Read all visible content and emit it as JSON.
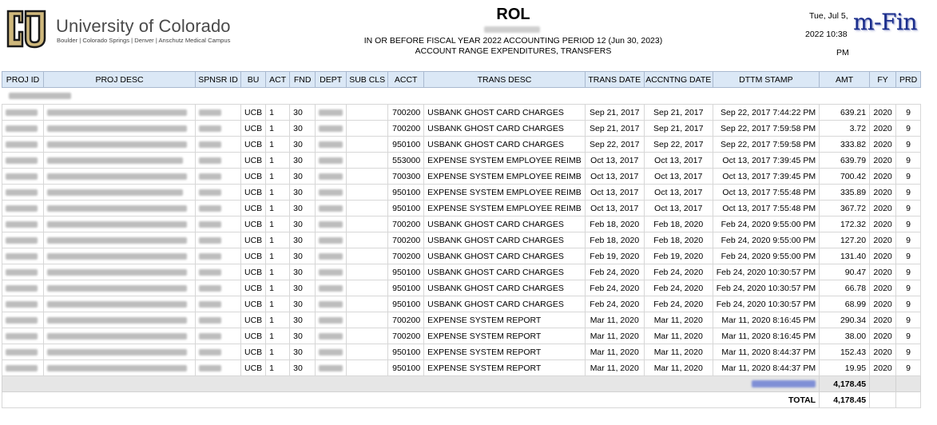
{
  "header": {
    "university": "University of Colorado",
    "campuses": "Boulder | Colorado Springs | Denver | Anschutz Medical Campus",
    "title": "ROL",
    "subtitle_line1": "IN OR BEFORE FISCAL YEAR 2022 ACCOUNTING PERIOD 12 (Jun 30, 2023)",
    "subtitle_line2": "ACCOUNT RANGE EXPENDITURES, TRANSFERS",
    "run_day": "Tue, Jul 5,",
    "run_time": "2022 10:38",
    "run_ampm": "PM",
    "app_logo": "m-Fin",
    "colors": {
      "app_logo": "#1a2d8c",
      "header_bg": "#dbe8f6",
      "subtotal_bg": "#e6e6e6"
    }
  },
  "table": {
    "columns": [
      "PROJ ID",
      "PROJ DESC",
      "SPNSR ID",
      "BU",
      "ACT",
      "FND",
      "DEPT",
      "SUB CLS",
      "ACCT",
      "TRANS DESC",
      "TRANS DATE",
      "ACCNTNG DATE",
      "DTTM STAMP",
      "AMT",
      "FY",
      "PRD"
    ],
    "rows": [
      {
        "bu": "UCB",
        "act": "1",
        "fnd": "30",
        "acct": "700200",
        "desc": "USBANK GHOST CARD CHARGES",
        "trans_date": "Sep 21, 2017",
        "acct_date": "Sep 21, 2017",
        "stamp": "Sep 22, 2017 7:44:22 PM",
        "amt": "639.21",
        "fy": "2020",
        "prd": "9"
      },
      {
        "bu": "UCB",
        "act": "1",
        "fnd": "30",
        "acct": "700200",
        "desc": "USBANK GHOST CARD CHARGES",
        "trans_date": "Sep 21, 2017",
        "acct_date": "Sep 21, 2017",
        "stamp": "Sep 22, 2017 7:59:58 PM",
        "amt": "3.72",
        "fy": "2020",
        "prd": "9"
      },
      {
        "bu": "UCB",
        "act": "1",
        "fnd": "30",
        "acct": "950100",
        "desc": "USBANK GHOST CARD CHARGES",
        "trans_date": "Sep 22, 2017",
        "acct_date": "Sep 22, 2017",
        "stamp": "Sep 22, 2017 7:59:58 PM",
        "amt": "333.82",
        "fy": "2020",
        "prd": "9"
      },
      {
        "bu": "UCB",
        "act": "1",
        "fnd": "30",
        "acct": "553000",
        "desc": "EXPENSE SYSTEM EMPLOYEE REIMB",
        "trans_date": "Oct 13, 2017",
        "acct_date": "Oct 13, 2017",
        "stamp": "Oct 13, 2017 7:39:45 PM",
        "amt": "639.79",
        "fy": "2020",
        "prd": "9"
      },
      {
        "bu": "UCB",
        "act": "1",
        "fnd": "30",
        "acct": "700300",
        "desc": "EXPENSE SYSTEM EMPLOYEE REIMB",
        "trans_date": "Oct 13, 2017",
        "acct_date": "Oct 13, 2017",
        "stamp": "Oct 13, 2017 7:39:45 PM",
        "amt": "700.42",
        "fy": "2020",
        "prd": "9"
      },
      {
        "bu": "UCB",
        "act": "1",
        "fnd": "30",
        "acct": "950100",
        "desc": "EXPENSE SYSTEM EMPLOYEE REIMB",
        "trans_date": "Oct 13, 2017",
        "acct_date": "Oct 13, 2017",
        "stamp": "Oct 13, 2017 7:55:48 PM",
        "amt": "335.89",
        "fy": "2020",
        "prd": "9"
      },
      {
        "bu": "UCB",
        "act": "1",
        "fnd": "30",
        "acct": "950100",
        "desc": "EXPENSE SYSTEM EMPLOYEE REIMB",
        "trans_date": "Oct 13, 2017",
        "acct_date": "Oct 13, 2017",
        "stamp": "Oct 13, 2017 7:55:48 PM",
        "amt": "367.72",
        "fy": "2020",
        "prd": "9"
      },
      {
        "bu": "UCB",
        "act": "1",
        "fnd": "30",
        "acct": "700200",
        "desc": "USBANK GHOST CARD CHARGES",
        "trans_date": "Feb 18, 2020",
        "acct_date": "Feb 18, 2020",
        "stamp": "Feb 24, 2020 9:55:00 PM",
        "amt": "172.32",
        "fy": "2020",
        "prd": "9"
      },
      {
        "bu": "UCB",
        "act": "1",
        "fnd": "30",
        "acct": "700200",
        "desc": "USBANK GHOST CARD CHARGES",
        "trans_date": "Feb 18, 2020",
        "acct_date": "Feb 18, 2020",
        "stamp": "Feb 24, 2020 9:55:00 PM",
        "amt": "127.20",
        "fy": "2020",
        "prd": "9"
      },
      {
        "bu": "UCB",
        "act": "1",
        "fnd": "30",
        "acct": "700200",
        "desc": "USBANK GHOST CARD CHARGES",
        "trans_date": "Feb 19, 2020",
        "acct_date": "Feb 19, 2020",
        "stamp": "Feb 24, 2020 9:55:00 PM",
        "amt": "131.40",
        "fy": "2020",
        "prd": "9"
      },
      {
        "bu": "UCB",
        "act": "1",
        "fnd": "30",
        "acct": "950100",
        "desc": "USBANK GHOST CARD CHARGES",
        "trans_date": "Feb 24, 2020",
        "acct_date": "Feb 24, 2020",
        "stamp": "Feb 24, 2020 10:30:57 PM",
        "amt": "90.47",
        "fy": "2020",
        "prd": "9"
      },
      {
        "bu": "UCB",
        "act": "1",
        "fnd": "30",
        "acct": "950100",
        "desc": "USBANK GHOST CARD CHARGES",
        "trans_date": "Feb 24, 2020",
        "acct_date": "Feb 24, 2020",
        "stamp": "Feb 24, 2020 10:30:57 PM",
        "amt": "66.78",
        "fy": "2020",
        "prd": "9"
      },
      {
        "bu": "UCB",
        "act": "1",
        "fnd": "30",
        "acct": "950100",
        "desc": "USBANK GHOST CARD CHARGES",
        "trans_date": "Feb 24, 2020",
        "acct_date": "Feb 24, 2020",
        "stamp": "Feb 24, 2020 10:30:57 PM",
        "amt": "68.99",
        "fy": "2020",
        "prd": "9"
      },
      {
        "bu": "UCB",
        "act": "1",
        "fnd": "30",
        "acct": "700200",
        "desc": "EXPENSE SYSTEM REPORT",
        "trans_date": "Mar 11, 2020",
        "acct_date": "Mar 11, 2020",
        "stamp": "Mar 11, 2020 8:16:45 PM",
        "amt": "290.34",
        "fy": "2020",
        "prd": "9"
      },
      {
        "bu": "UCB",
        "act": "1",
        "fnd": "30",
        "acct": "700200",
        "desc": "EXPENSE SYSTEM REPORT",
        "trans_date": "Mar 11, 2020",
        "acct_date": "Mar 11, 2020",
        "stamp": "Mar 11, 2020 8:16:45 PM",
        "amt": "38.00",
        "fy": "2020",
        "prd": "9"
      },
      {
        "bu": "UCB",
        "act": "1",
        "fnd": "30",
        "acct": "950100",
        "desc": "EXPENSE SYSTEM REPORT",
        "trans_date": "Mar 11, 2020",
        "acct_date": "Mar 11, 2020",
        "stamp": "Mar 11, 2020 8:44:37 PM",
        "amt": "152.43",
        "fy": "2020",
        "prd": "9"
      },
      {
        "bu": "UCB",
        "act": "1",
        "fnd": "30",
        "acct": "950100",
        "desc": "EXPENSE SYSTEM REPORT",
        "trans_date": "Mar 11, 2020",
        "acct_date": "Mar 11, 2020",
        "stamp": "Mar 11, 2020 8:44:37 PM",
        "amt": "19.95",
        "fy": "2020",
        "prd": "9"
      }
    ],
    "subtotal_amt": "4,178.45",
    "total_label": "TOTAL",
    "total_amt": "4,178.45"
  }
}
